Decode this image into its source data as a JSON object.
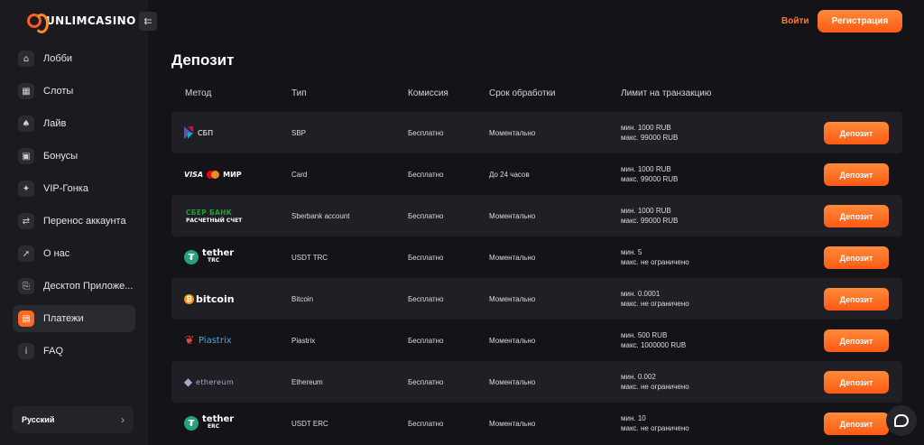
{
  "sidebar": {
    "logo_text": "UNLIMCASINO",
    "collapse_icon": "collapse-icon",
    "items": [
      {
        "label": "Лобби",
        "icon": "home-icon",
        "glyph": "⌂",
        "active": false
      },
      {
        "label": "Слоты",
        "icon": "slots-icon",
        "glyph": "▦",
        "active": false
      },
      {
        "label": "Лайв",
        "icon": "spade-icon",
        "glyph": "♠",
        "active": false
      },
      {
        "label": "Бонусы",
        "icon": "bonus-icon",
        "glyph": "▣",
        "active": false
      },
      {
        "label": "VIP-Гонка",
        "icon": "vip-icon",
        "glyph": "✦",
        "active": false
      },
      {
        "label": "Перенос аккаунта",
        "icon": "transfer-icon",
        "glyph": "⇄",
        "active": false
      },
      {
        "label": "О нас",
        "icon": "rocket-icon",
        "glyph": "➚",
        "active": false
      },
      {
        "label": "Десктоп Приложе...",
        "icon": "desktop-icon",
        "glyph": "⎘",
        "active": false
      },
      {
        "label": "Платежи",
        "icon": "wallet-icon",
        "glyph": "▤",
        "active": true
      },
      {
        "label": "FAQ",
        "icon": "info-icon",
        "glyph": "i",
        "active": false
      }
    ],
    "language": "Русский"
  },
  "header": {
    "login_label": "Войти",
    "register_label": "Регистрация"
  },
  "main": {
    "title": "Депозит",
    "columns": {
      "method": "Метод",
      "type": "Тип",
      "fee": "Комиссия",
      "time": "Срок обработки",
      "limit": "Лимит на транзакцию"
    },
    "rows": [
      {
        "logo": "sbp",
        "logo_text": "СБП",
        "type": "SBP",
        "fee": "Бесплатно",
        "time": "Моментально",
        "min": "мин. 1000 RUB",
        "max": "макс. 99000 RUB",
        "button": "Депозит"
      },
      {
        "logo": "card",
        "logo_text": [
          "VISA",
          "МИР"
        ],
        "type": "Card",
        "fee": "Бесплатно",
        "time": "До 24 часов",
        "min": "мин. 1000 RUB",
        "max": "макс. 99000 RUB",
        "button": "Депозит"
      },
      {
        "logo": "sber",
        "logo_text": [
          "СБЕР БАНК",
          "РАСЧЕТНЫЙ СЧЕТ"
        ],
        "type": "Sberbank account",
        "fee": "Бесплатно",
        "time": "Моментально",
        "min": "мин. 1000 RUB",
        "max": "макс. 99000 RUB",
        "button": "Депозит"
      },
      {
        "logo": "tether",
        "logo_text": [
          "tether",
          "TRC"
        ],
        "type": "USDT TRC",
        "fee": "Бесплатно",
        "time": "Моментально",
        "min": "мин. 5",
        "max": "макс. не ограничено",
        "button": "Депозит"
      },
      {
        "logo": "bitcoin",
        "logo_text": "bitcoin",
        "type": "Bitcoin",
        "fee": "Бесплатно",
        "time": "Моментально",
        "min": "мин. 0.0001",
        "max": "макс. не ограничено",
        "button": "Депозит"
      },
      {
        "logo": "piastrix",
        "logo_text": "Piastrix",
        "type": "Piastrix",
        "fee": "Бесплатно",
        "time": "Моментально",
        "min": "мин. 500 RUB",
        "max": "макс. 1000000 RUB",
        "button": "Депозит"
      },
      {
        "logo": "ethereum",
        "logo_text": "ethereum",
        "type": "Ethereum",
        "fee": "Бесплатно",
        "time": "Моментально",
        "min": "мин. 0.002",
        "max": "макс. не ограничено",
        "button": "Депозит"
      },
      {
        "logo": "tether",
        "logo_text": [
          "tether",
          "ERC"
        ],
        "type": "USDT ERC",
        "fee": "Бесплатно",
        "time": "Моментально",
        "min": "мин. 10",
        "max": "макс. не ограничено",
        "button": "Депозит"
      }
    ]
  },
  "chat_icon": "chat-icon",
  "colors": {
    "accent": "#ff6a23",
    "background": "#141418",
    "sidebar": "#1a1a1f",
    "row_alt": "#1f1f25"
  }
}
